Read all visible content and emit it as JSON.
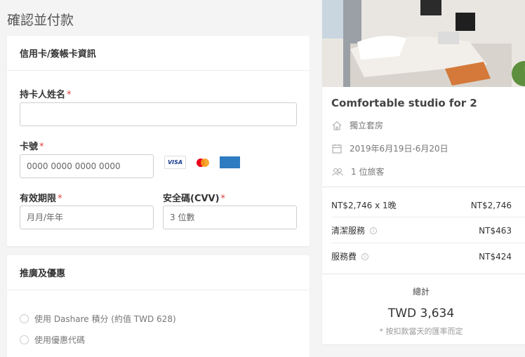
{
  "page": {
    "title": "確認並付款"
  },
  "payment": {
    "section_title": "信用卡/簽帳卡資訊",
    "name_label": "持卡人姓名",
    "name_placeholder": "",
    "card_number_label": "卡號",
    "card_number_placeholder": "0000 0000 0000 0000",
    "card_logos": [
      "VISA",
      "mastercard",
      "AMERICAN EXPRESS"
    ],
    "expiry_label": "有效期限",
    "expiry_placeholder": "月月/年年",
    "cvv_label": "安全碼(CVV)",
    "cvv_placeholder": "3 位數",
    "required_mark": "*"
  },
  "promo": {
    "section_title": "推廣及優惠",
    "options": [
      {
        "label": "使用 Dashare 積分 (約值 TWD 628)"
      },
      {
        "label": "使用優惠代碼"
      }
    ]
  },
  "summary": {
    "listing_title": "Comfortable studio for 2",
    "room_type": "獨立套房",
    "dates": "2019年6月19日-6月20日",
    "guests": "1 位旅客",
    "price_lines": [
      {
        "label": "NT$2,746 x 1晚",
        "value": "NT$2,746"
      },
      {
        "label": "清潔服務",
        "value": "NT$463"
      },
      {
        "label": "服務費",
        "value": "NT$424"
      }
    ],
    "total_label": "總計",
    "total_value": "TWD 3,634",
    "total_note": "* 按扣款當天的匯率而定"
  },
  "colors": {
    "required": "#e03c3c",
    "background": "#f4f4f4",
    "card": "#ffffff"
  }
}
